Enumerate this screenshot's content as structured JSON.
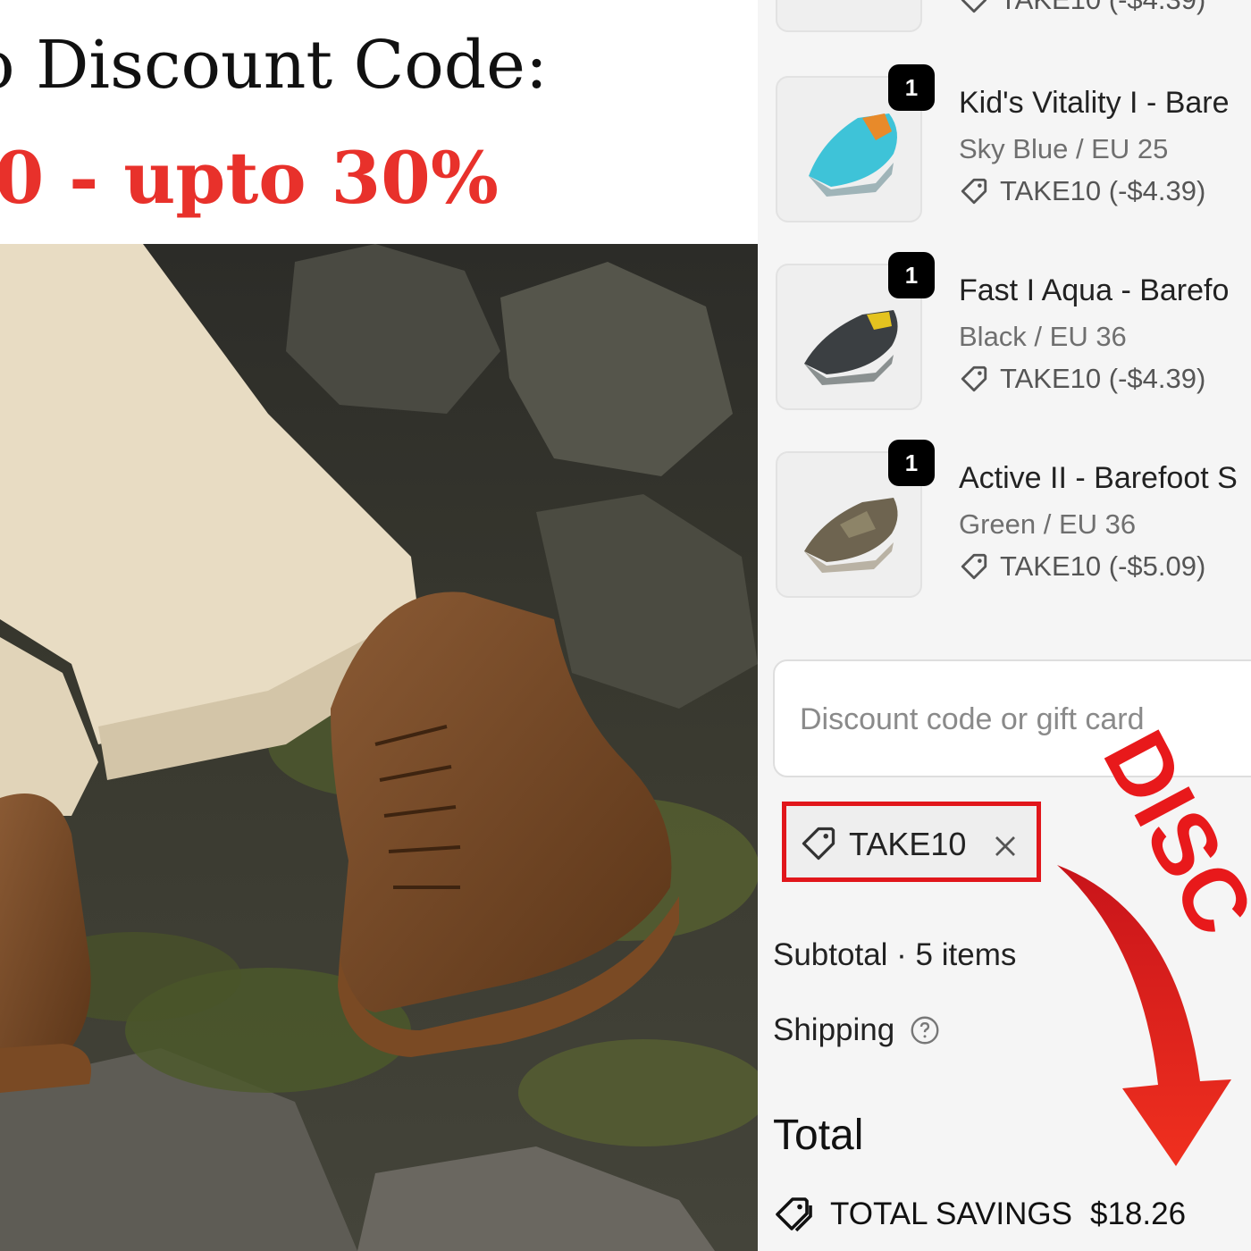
{
  "promo": {
    "line1": "o Discount Code:",
    "line2": "10 - upto 30%"
  },
  "cart": {
    "top_item_discount": "TAKE10 (-$4.39)",
    "items": [
      {
        "qty": "1",
        "name": "Kid's Vitality I - Bare",
        "variant": "Sky Blue / EU 25",
        "discount": "TAKE10 (-$4.39)"
      },
      {
        "qty": "1",
        "name": "Fast I Aqua - Barefo",
        "variant": "Black / EU 36",
        "discount": "TAKE10 (-$4.39)"
      },
      {
        "qty": "1",
        "name": "Active II - Barefoot S",
        "variant": "Green / EU 36",
        "discount": "TAKE10 (-$5.09)"
      }
    ],
    "discount_input": {
      "placeholder": "Discount code or gift card"
    },
    "applied_code": "TAKE10",
    "subtotal_label": "Subtotal · 5 items",
    "shipping_label": "Shipping",
    "total_label": "Total",
    "savings_label": "TOTAL SAVINGS",
    "savings_value": "$18.26"
  },
  "overlay": {
    "annotation_text": "DISC",
    "accent_color": "#e8191b"
  }
}
